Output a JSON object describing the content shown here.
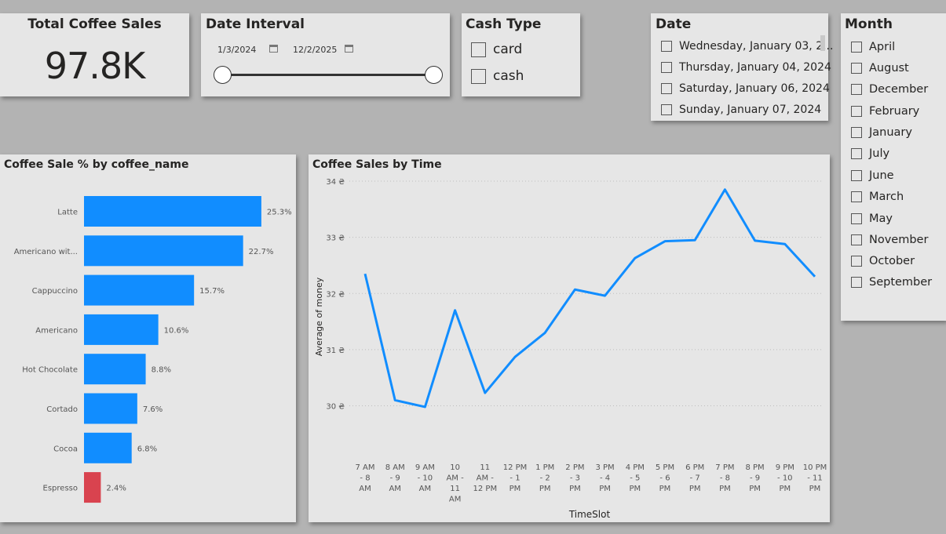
{
  "kpi": {
    "title": "Total Coffee Sales",
    "value": "97.8K"
  },
  "date_interval": {
    "title": "Date Interval",
    "start": "1/3/2024",
    "end": "12/2/2025"
  },
  "cash_type": {
    "title": "Cash Type",
    "options": [
      "card",
      "cash"
    ]
  },
  "date_slicer": {
    "title": "Date",
    "items": [
      "Wednesday, January 03, 2...",
      "Thursday, January 04, 2024",
      "Saturday, January 06, 2024",
      "Sunday, January 07, 2024"
    ]
  },
  "month_slicer": {
    "title": "Month",
    "items": [
      "April",
      "August",
      "December",
      "February",
      "January",
      "July",
      "June",
      "March",
      "May",
      "November",
      "October",
      "September"
    ]
  },
  "colors": {
    "bar_default": "#118dff",
    "bar_highlight": "#d9434f",
    "line": "#118dff",
    "background": "#b3b3b3",
    "card": "#e6e6e6"
  },
  "chart_data": [
    {
      "type": "bar",
      "title": "Coffee Sale % by coffee_name",
      "categories": [
        "Latte",
        "Americano wit...",
        "Cappuccino",
        "Americano",
        "Hot Chocolate",
        "Cortado",
        "Cocoa",
        "Espresso"
      ],
      "values": [
        25.3,
        22.7,
        15.7,
        10.6,
        8.8,
        7.6,
        6.8,
        2.4
      ],
      "data_labels": [
        "25.3%",
        "22.7%",
        "15.7%",
        "10.6%",
        "8.8%",
        "7.6%",
        "6.8%",
        "2.4%"
      ],
      "highlight_category": "Espresso",
      "orientation": "horizontal"
    },
    {
      "type": "line",
      "title": "Coffee Sales by Time",
      "xlabel": "TimeSlot",
      "ylabel": "Average of money",
      "x": [
        "7 AM - 8 AM",
        "8 AM - 9 AM",
        "9 AM - 10 AM",
        "10 AM - 11 AM",
        "11 AM - 12 PM",
        "12 PM - 1 PM",
        "1 PM - 2 PM",
        "2 PM - 3 PM",
        "3 PM - 4 PM",
        "4 PM - 5 PM",
        "5 PM - 6 PM",
        "6 PM - 7 PM",
        "7 PM - 8 PM",
        "8 PM - 9 PM",
        "9 PM - 10 PM",
        "10 PM - 11 PM"
      ],
      "x_tick_lines": [
        [
          "7 AM",
          "- 8",
          "AM"
        ],
        [
          "8 AM",
          "- 9",
          "AM"
        ],
        [
          "9 AM",
          "- 10",
          "AM"
        ],
        [
          "10",
          "AM -",
          "11",
          "AM"
        ],
        [
          "11",
          "AM -",
          "12 PM"
        ],
        [
          "12 PM",
          "- 1",
          "PM"
        ],
        [
          "1 PM",
          "- 2",
          "PM"
        ],
        [
          "2 PM",
          "- 3",
          "PM"
        ],
        [
          "3 PM",
          "- 4",
          "PM"
        ],
        [
          "4 PM",
          "- 5",
          "PM"
        ],
        [
          "5 PM",
          "- 6",
          "PM"
        ],
        [
          "6 PM",
          "- 7",
          "PM"
        ],
        [
          "7 PM",
          "- 8",
          "PM"
        ],
        [
          "8 PM",
          "- 9",
          "PM"
        ],
        [
          "9 PM",
          "- 10",
          "PM"
        ],
        [
          "10 PM",
          "- 11",
          "PM"
        ]
      ],
      "values": [
        32.35,
        30.1,
        29.98,
        31.7,
        30.23,
        30.87,
        31.3,
        32.07,
        31.96,
        32.63,
        32.93,
        32.95,
        33.85,
        32.94,
        32.88,
        32.3
      ],
      "ylim": [
        29.7,
        34.0
      ],
      "y_ticks": [
        30,
        31,
        32,
        33,
        34
      ],
      "y_tick_labels": [
        "30 ₴",
        "31 ₴",
        "32 ₴",
        "33 ₴",
        "34 ₴"
      ],
      "grid": true
    }
  ]
}
